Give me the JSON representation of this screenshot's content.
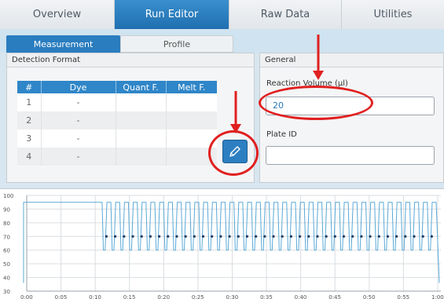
{
  "top_tabs": [
    "Overview",
    "Run Editor",
    "Raw Data",
    "Utilities"
  ],
  "sub_tabs": [
    "Measurement",
    "Profile"
  ],
  "detection_format": {
    "title": "Detection Format",
    "columns": [
      "#",
      "Dye",
      "Quant F.",
      "Melt F."
    ],
    "rows": [
      {
        "num": "1",
        "dye": "-"
      },
      {
        "num": "2",
        "dye": "-"
      },
      {
        "num": "3",
        "dye": "-"
      },
      {
        "num": "4",
        "dye": "-"
      }
    ]
  },
  "general": {
    "title": "General",
    "reaction_volume_label": "Reaction Volume (µl)",
    "reaction_volume_value": "20",
    "plate_id_label": "Plate ID",
    "plate_id_value": ""
  },
  "icons": {
    "edit": "pencil-icon"
  },
  "colors": {
    "accent": "#2f86c8",
    "annotation": "#e02020",
    "profile_line": "#5aa9d6"
  },
  "chart_data": {
    "type": "line",
    "y_ticks": [
      "100",
      "90",
      "80",
      "70",
      "60",
      "50",
      "40",
      "30"
    ],
    "x_ticks": [
      "0:00",
      "0:05",
      "0:10",
      "0:15",
      "0:20",
      "0:25",
      "0:30",
      "0:35",
      "0:40",
      "0:45",
      "0:50",
      "0:55",
      "1:00"
    ],
    "ylim": [
      30,
      100
    ],
    "grid": true,
    "initial_hold": {
      "temp": 95,
      "until": "0:11"
    },
    "cycle": {
      "high": 95,
      "low": 60,
      "measure_point": 70,
      "count": 38
    }
  }
}
